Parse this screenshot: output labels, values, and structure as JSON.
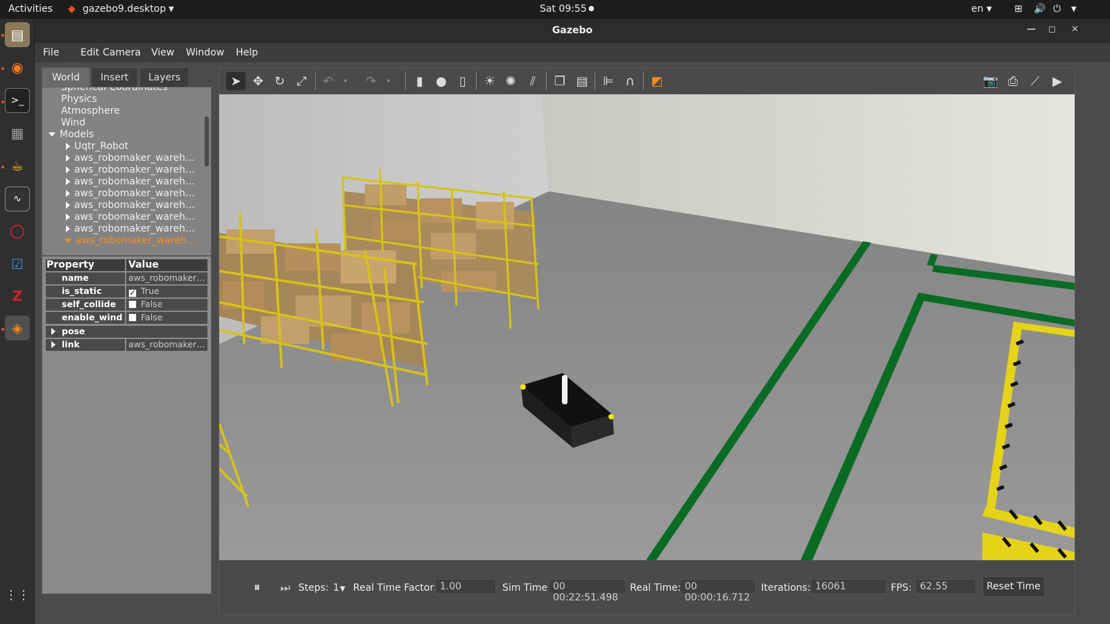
{
  "topbar": {
    "activities": "Activities",
    "app_name": "gazebo9.desktop",
    "clock": "Sat 09:55",
    "lang": "en"
  },
  "dock": {
    "apps": [
      "files-icon",
      "firefox-icon",
      "terminal-icon",
      "calculator-icon",
      "gnome-teapot-icon",
      "system-monitor-icon",
      "opera-icon",
      "tasks-icon",
      "zotero-icon",
      "gazebo-icon"
    ],
    "show_apps": "app-grid-icon"
  },
  "window": {
    "title": "Gazebo"
  },
  "menu": {
    "file": "File",
    "edit": "Edit",
    "camera": "Camera",
    "view": "View",
    "window": "Window",
    "help": "Help"
  },
  "tabs": {
    "world": "World",
    "insert": "Insert",
    "layers": "Layers"
  },
  "tree": {
    "spherical": "Spherical Coordinates",
    "physics": "Physics",
    "atmosphere": "Atmosphere",
    "wind": "Wind",
    "models": "Models",
    "model_items": [
      "Uqtr_Robot",
      "aws_robomaker_wareh…",
      "aws_robomaker_wareh…",
      "aws_robomaker_wareh…",
      "aws_robomaker_wareh…",
      "aws_robomaker_wareh…",
      "aws_robomaker_wareh…",
      "aws_robomaker_wareh…"
    ],
    "selected": "aws_robomaker_wareh…"
  },
  "properties": {
    "header_key": "Property",
    "header_value": "Value",
    "name_key": "name",
    "name_value": "aws_robomaker…",
    "is_static_key": "is_static",
    "is_static_value": "True",
    "self_collide_key": "self_collide",
    "self_collide_value": "False",
    "enable_wind_key": "enable_wind",
    "enable_wind_value": "False",
    "pose_key": "pose",
    "link_key": "link",
    "link_value": "aws_robomaker…"
  },
  "bottombar": {
    "steps_label": "Steps:",
    "steps_value": "1",
    "rtf_label": "Real Time Factor:",
    "rtf_value": "1.00",
    "sim_label": "Sim Time:",
    "sim_value": "00 00:22:51.498",
    "real_label": "Real Time:",
    "real_value": "00 00:00:16.712",
    "iter_label": "Iterations:",
    "iter_value": "16061",
    "fps_label": "FPS:",
    "fps_value": "62.55",
    "reset": "Reset Time"
  },
  "colors": {
    "accent": "#ff8c1a",
    "topbar": "#1d1d1d",
    "panel": "#828282",
    "floor": "#8c8c8c",
    "shelf": "#d6c21a",
    "tape": "#0a6b25"
  }
}
